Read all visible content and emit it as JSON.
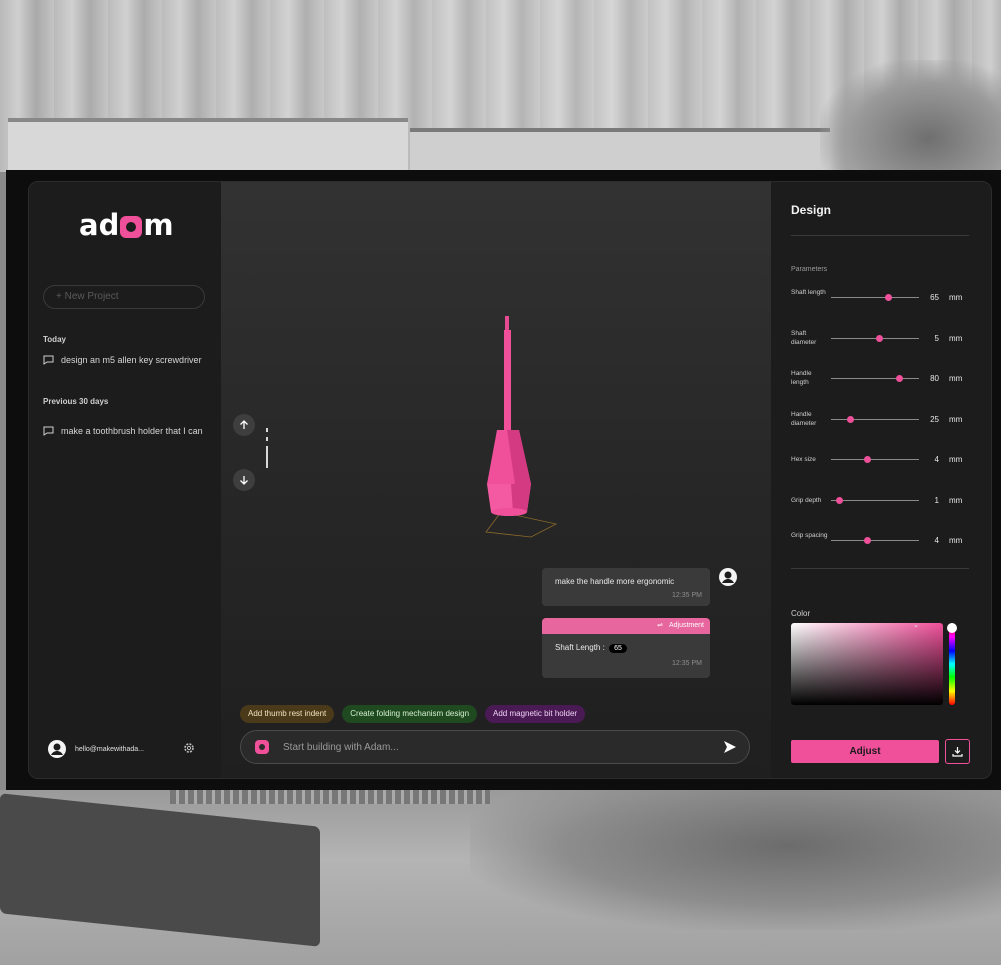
{
  "brand": {
    "logo_text": "adam",
    "accent": "#f0509a"
  },
  "sidebar": {
    "new_project_label": "+ New Project",
    "sections": [
      {
        "label": "Today",
        "items": [
          {
            "label": "design an m5 allen key screwdriver"
          }
        ]
      },
      {
        "label": "Previous 30 days",
        "items": [
          {
            "label": "make a toothbrush holder that I can"
          }
        ]
      }
    ],
    "user_email": "hello@makewithada..."
  },
  "viewport": {
    "messages": [
      {
        "role": "user",
        "text": "make the handle more ergonomic",
        "time": "12:35 PM"
      },
      {
        "role": "assistant",
        "header": "Adjustment",
        "field": "Shaft Length :",
        "value": "65",
        "time": "12:35 PM"
      }
    ],
    "suggestions": [
      {
        "label": "Add thumb rest indent"
      },
      {
        "label": "Create folding mechanism design"
      },
      {
        "label": "Add magnetic bit holder"
      }
    ],
    "prompt_placeholder": "Start building with Adam..."
  },
  "design_panel": {
    "title": "Design",
    "parameters_label": "Parameters",
    "parameters": [
      {
        "label": "Shaft length",
        "value": "65",
        "unit": "mm",
        "level": 0.65
      },
      {
        "label": "Shaft diameter",
        "value": "5",
        "unit": "mm",
        "level": 0.55
      },
      {
        "label": "Handle length",
        "value": "80",
        "unit": "mm",
        "level": 0.78
      },
      {
        "label": "Handle diameter",
        "value": "25",
        "unit": "mm",
        "level": 0.22
      },
      {
        "label": "Hex size",
        "value": "4",
        "unit": "mm",
        "level": 0.42
      },
      {
        "label": "Grip depth",
        "value": "1",
        "unit": "mm",
        "level": 0.1
      },
      {
        "label": "Grip spacing",
        "value": "4",
        "unit": "mm",
        "level": 0.42
      }
    ],
    "color_label": "Color",
    "selected_color": "#f0509a",
    "adjust_label": "Adjust"
  }
}
